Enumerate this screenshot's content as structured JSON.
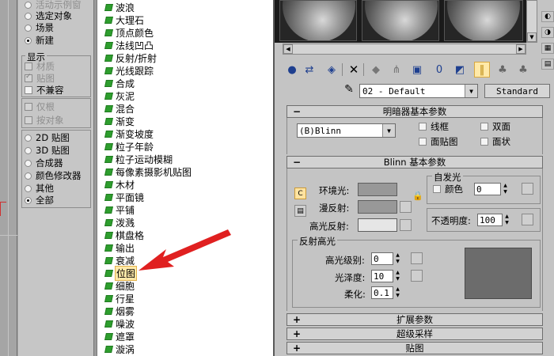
{
  "left_panel": {
    "top_options": [
      {
        "label": "活动示例窗",
        "selected": false,
        "dim": true
      },
      {
        "label": "选定对象",
        "selected": false
      },
      {
        "label": "场景",
        "selected": false
      },
      {
        "label": "新建",
        "selected": true
      }
    ],
    "display_group": {
      "title": "显示",
      "items": [
        {
          "label": "材质",
          "checked": false,
          "disabled": true
        },
        {
          "label": "贴图",
          "checked": true,
          "disabled": true
        },
        {
          "label": "不兼容",
          "checked": false,
          "disabled": false
        }
      ]
    },
    "filter_group": {
      "items": [
        {
          "label": "仅根",
          "disabled": true
        },
        {
          "label": "按对象",
          "disabled": true
        }
      ]
    },
    "type_group": {
      "items": [
        {
          "label": "2D 贴图",
          "selected": false
        },
        {
          "label": "3D 贴图",
          "selected": false
        },
        {
          "label": "合成器",
          "selected": false
        },
        {
          "label": "颜色修改器",
          "selected": false
        },
        {
          "label": "其他",
          "selected": false
        },
        {
          "label": "全部",
          "selected": true
        }
      ]
    }
  },
  "map_list": {
    "items": [
      "波浪",
      "大理石",
      "顶点颜色",
      "法线凹凸",
      "反射/折射",
      "光线跟踪",
      "合成",
      "灰泥",
      "混合",
      "渐变",
      "渐变坡度",
      "粒子年龄",
      "粒子运动模糊",
      "每像素摄影机贴图",
      "木材",
      "平面镜",
      "平铺",
      "泼溅",
      "棋盘格",
      "输出",
      "衰减",
      "位图",
      "细胞",
      "行星",
      "烟雾",
      "噪波",
      "遮罩",
      "漩涡"
    ],
    "selected": "位图"
  },
  "material_editor": {
    "material_name": "02 - Default",
    "type_button": "Standard",
    "shader_rollout": {
      "title": "明暗器基本参数",
      "shader": "(B)Blinn",
      "options": [
        {
          "label": "线框",
          "checked": false
        },
        {
          "label": "双面",
          "checked": false
        },
        {
          "label": "面贴图",
          "checked": false
        },
        {
          "label": "面状",
          "checked": false
        }
      ]
    },
    "blinn_rollout": {
      "title": "Blinn 基本参数",
      "self_illum_group": "自发光",
      "self_illum_color_label": "颜色",
      "self_illum_value": "0",
      "ambient_label": "环境光:",
      "diffuse_label": "漫反射:",
      "specular_label": "高光反射:",
      "opacity_label": "不透明度:",
      "opacity_value": "100",
      "lock_icon": "lock-icon",
      "colors": {
        "ambient": "#989898",
        "diffuse": "#989898",
        "specular": "#e6e6e6",
        "preview": "#6c6c6c"
      }
    },
    "highlight_group": {
      "title": "反射高光",
      "spec_level_label": "高光级别:",
      "spec_level_value": "0",
      "gloss_label": "光泽度:",
      "gloss_value": "10",
      "soften_label": "柔化:",
      "soften_value": "0.1"
    },
    "collapsed_rollouts": [
      "扩展参数",
      "超级采样",
      "贴图"
    ]
  }
}
